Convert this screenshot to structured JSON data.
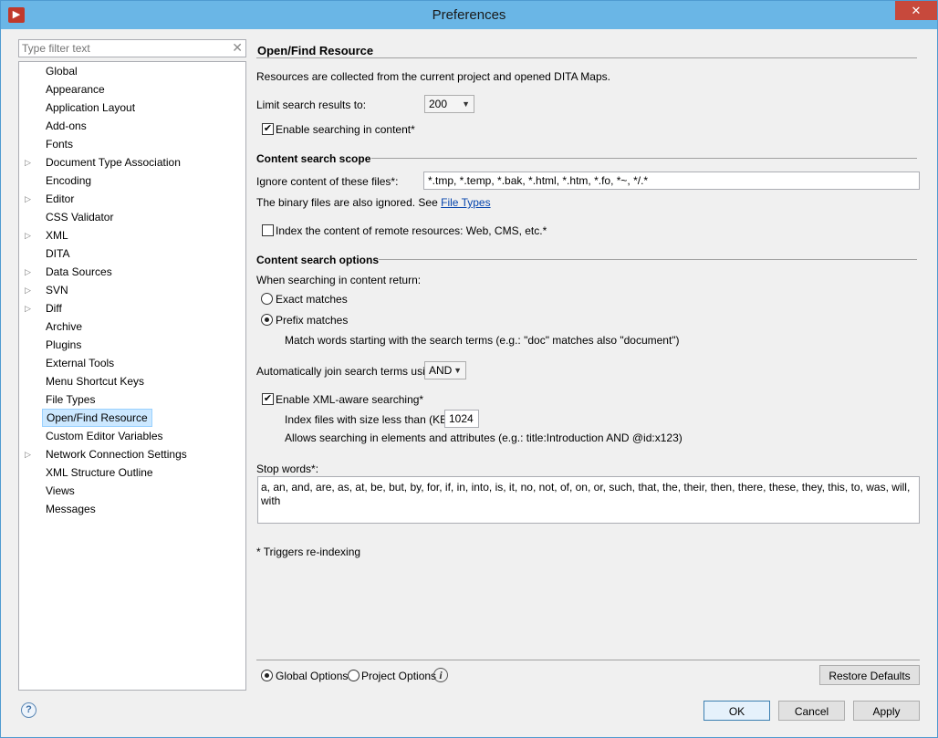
{
  "window": {
    "title": "Preferences",
    "close_glyph": "✕",
    "app_icon_glyph": "▶"
  },
  "filter": {
    "placeholder": "Type filter text"
  },
  "tree": {
    "items": [
      {
        "label": "Global",
        "expandable": false
      },
      {
        "label": "Appearance",
        "expandable": false
      },
      {
        "label": "Application Layout",
        "expandable": false
      },
      {
        "label": "Add-ons",
        "expandable": false
      },
      {
        "label": "Fonts",
        "expandable": false
      },
      {
        "label": "Document Type Association",
        "expandable": true
      },
      {
        "label": "Encoding",
        "expandable": false
      },
      {
        "label": "Editor",
        "expandable": true
      },
      {
        "label": "CSS Validator",
        "expandable": false
      },
      {
        "label": "XML",
        "expandable": true
      },
      {
        "label": "DITA",
        "expandable": false
      },
      {
        "label": "Data Sources",
        "expandable": true
      },
      {
        "label": "SVN",
        "expandable": true
      },
      {
        "label": "Diff",
        "expandable": true
      },
      {
        "label": "Archive",
        "expandable": false
      },
      {
        "label": "Plugins",
        "expandable": false
      },
      {
        "label": "External Tools",
        "expandable": false
      },
      {
        "label": "Menu Shortcut Keys",
        "expandable": false
      },
      {
        "label": "File Types",
        "expandable": false
      },
      {
        "label": "Open/Find Resource",
        "expandable": false,
        "selected": true
      },
      {
        "label": "Custom Editor Variables",
        "expandable": false
      },
      {
        "label": "Network Connection Settings",
        "expandable": true
      },
      {
        "label": "XML Structure Outline",
        "expandable": false
      },
      {
        "label": "Views",
        "expandable": false
      },
      {
        "label": "Messages",
        "expandable": false
      }
    ]
  },
  "page": {
    "title": "Open/Find Resource",
    "description": "Resources are collected from the current project and opened DITA Maps.",
    "limit_label": "Limit search results to:",
    "limit_value": "200",
    "enable_content_search": {
      "label": "Enable searching in content*",
      "checked": true
    },
    "scope": {
      "title": "Content search scope",
      "ignore_label": "Ignore content of these files*:",
      "ignore_value": "*.tmp, *.temp, *.bak, *.html, *.htm, *.fo, *~, */.*",
      "binary_note": "The binary files are also ignored. See",
      "binary_link": "File Types",
      "remote": {
        "label": "Index the content of remote resources: Web, CMS, etc.*",
        "checked": false
      }
    },
    "options": {
      "title": "Content search options",
      "return_label": "When searching in content return:",
      "exact": {
        "label": "Exact matches",
        "checked": false
      },
      "prefix": {
        "label": "Prefix matches",
        "checked": true
      },
      "prefix_note": "Match words starting with the search terms (e.g.: \"doc\" matches also \"document\")",
      "join_label": "Automatically join search terms using:",
      "join_value": "AND",
      "xml_aware": {
        "label": "Enable XML-aware searching*",
        "checked": true
      },
      "index_size_label": "Index files with size less than (KB)*:",
      "index_size_value": "1024",
      "xml_note": "Allows searching in elements and attributes (e.g.: title:Introduction AND @id:x123)"
    },
    "stop_words_label": "Stop words*:",
    "stop_words_value": "a, an, and, are, as, at, be, but, by, for, if, in, into, is, it, no, not, of, on, or, such, that, the, their, then, there, these, they, this, to, was, will, with",
    "reindex_note": "* Triggers re-indexing"
  },
  "scope_footer": {
    "global": {
      "label": "Global Options",
      "checked": true
    },
    "project": {
      "label": "Project Options",
      "checked": false
    },
    "restore_label": "Restore Defaults"
  },
  "dialog_buttons": {
    "ok": "OK",
    "cancel": "Cancel",
    "apply": "Apply"
  },
  "checkmark_glyph": "✔",
  "caret_glyph": "▼",
  "tree_arrow_glyph": "▷",
  "help_glyph": "?",
  "info_glyph": "i",
  "clear_glyph": "✕"
}
